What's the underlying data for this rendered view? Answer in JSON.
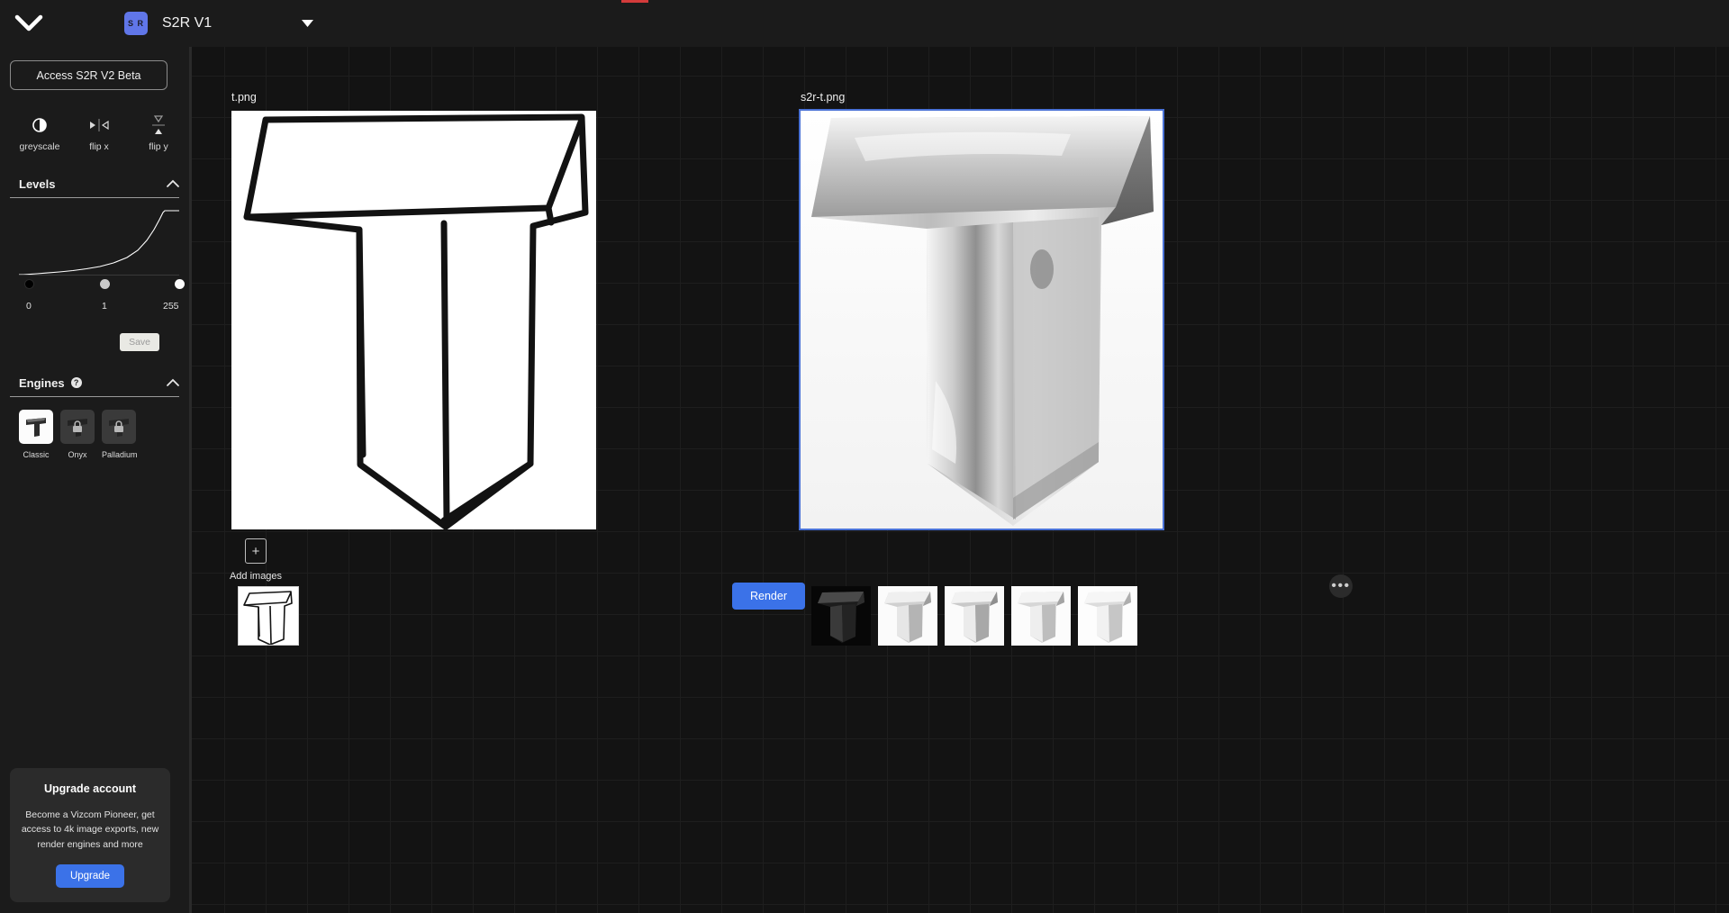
{
  "app": {
    "brand_badge": "S R",
    "document_title": "S2R V1",
    "home_icon": "chevron-down-icon",
    "title_caret_icon": "caret-down-icon"
  },
  "sidebar": {
    "beta_button": "Access S2R V2 Beta",
    "tools": [
      {
        "id": "greyscale",
        "label": "greyscale",
        "icon": "contrast-half-circle-icon"
      },
      {
        "id": "flip-x",
        "label": "flip x",
        "icon": "flip-horizontal-icon"
      },
      {
        "id": "flip-y",
        "label": "flip y",
        "icon": "flip-vertical-icon"
      }
    ],
    "levels": {
      "title": "Levels",
      "collapse_icon": "chevron-up-icon",
      "black_point": "0",
      "gamma": "1",
      "white_point": "255",
      "save_label": "Save"
    },
    "engines": {
      "title": "Engines",
      "help_icon": "question-mark-icon",
      "collapse_icon": "chevron-up-icon",
      "items": [
        {
          "label": "Classic",
          "selected": true,
          "locked": false
        },
        {
          "label": "Onyx",
          "selected": false,
          "locked": true
        },
        {
          "label": "Palladium",
          "selected": false,
          "locked": true
        }
      ]
    },
    "upgrade": {
      "heading": "Upgrade account",
      "body": "Become a Vizcom Pioneer, get access to 4k image exports, new render engines and more",
      "button": "Upgrade"
    }
  },
  "canvas": {
    "source_image": {
      "caption": "t.png",
      "selected": false
    },
    "result_image": {
      "caption": "s2r-t.png",
      "selected": true
    },
    "render_button": "Render",
    "add_images": {
      "label": "Add images",
      "icon": "plus-in-box-icon"
    },
    "overflow_menu_icon": "ellipsis-icon",
    "result_thumbnails": [
      {
        "name": "render-thumb-1",
        "variant": "dark"
      },
      {
        "name": "render-thumb-2",
        "variant": "light"
      },
      {
        "name": "render-thumb-3",
        "variant": "light"
      },
      {
        "name": "render-thumb-4",
        "variant": "light"
      },
      {
        "name": "render-thumb-5",
        "variant": "light"
      }
    ]
  },
  "colors": {
    "accent": "#3b72e8",
    "brand_badge": "#6076e8",
    "selection_border": "#4a72d6",
    "panel": "#1b1b1b",
    "canvas": "#131313"
  }
}
